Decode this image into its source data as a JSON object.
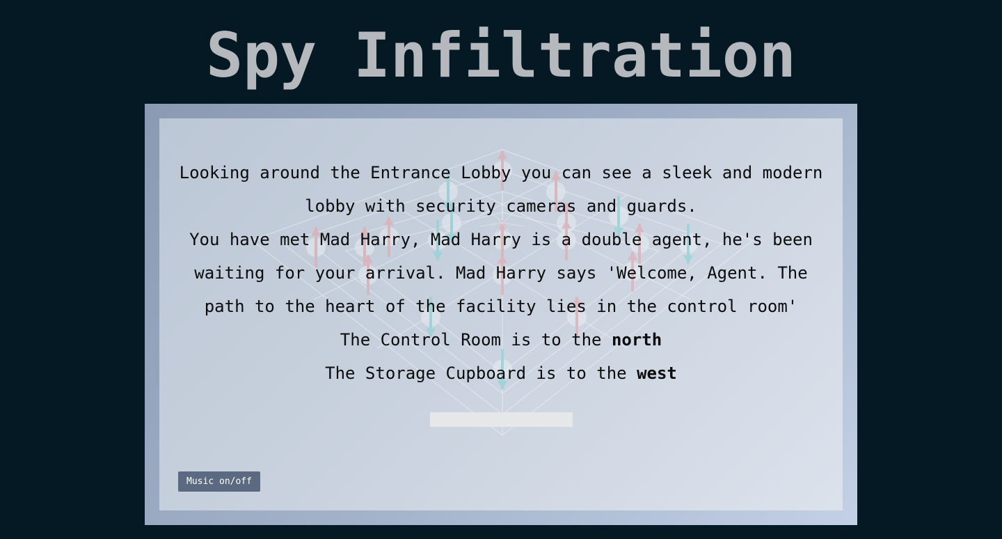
{
  "header": {
    "title": "Spy Infiltration"
  },
  "story": {
    "description": "Looking around the Entrance Lobby you can see a sleek and modern lobby with security cameras and guards.",
    "encounter": "You have met Mad Harry, Mad Harry is a double agent, he's been waiting for your arrival. Mad Harry says 'Welcome, Agent. The path to the heart of the facility lies in the control room'",
    "exits": [
      {
        "prefix": "The Control Room is to the ",
        "direction": "north"
      },
      {
        "prefix": "The Storage Cupboard is to the ",
        "direction": "west"
      }
    ]
  },
  "command_input": {
    "value": "",
    "placeholder": ""
  },
  "controls": {
    "music_label": "Music on/off"
  },
  "colors": {
    "page_background": "#041923",
    "title": "#b5b9bd",
    "button": "#5b6a80",
    "arrow_red": "#e8a3a8",
    "arrow_cyan": "#7fd3d6"
  },
  "icons": {
    "background_art": "isometric-grid-with-spin-arrows"
  }
}
